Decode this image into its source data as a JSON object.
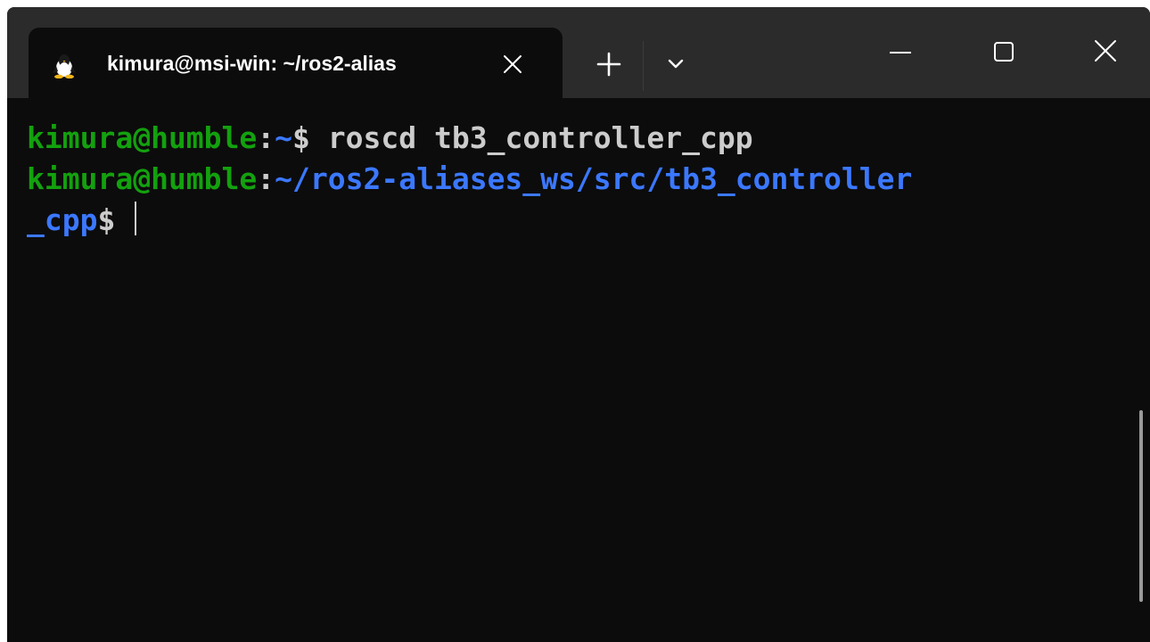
{
  "tab": {
    "title": "kimura@msi-win: ~/ros2-alias",
    "icon": "linux-penguin-icon"
  },
  "titlebar": {
    "new_tab_icon": "plus-icon",
    "dropdown_icon": "chevron-down-icon",
    "window_controls": [
      "minimize-icon",
      "maximize-icon",
      "close-icon"
    ]
  },
  "terminal": {
    "lines": [
      {
        "user_host": "kimura@humble",
        "sep": ":",
        "path": "~",
        "prompt": "$ ",
        "command": "roscd tb3_controller_cpp"
      },
      {
        "user_host": "kimura@humble",
        "sep": ":",
        "path": "~/ros2-aliases_ws/src/tb3_controller",
        "prompt": "",
        "command": ""
      },
      {
        "user_host": "",
        "sep": "",
        "path": "_cpp",
        "prompt": "$ ",
        "command": ""
      }
    ]
  },
  "colors": {
    "background": "#0c0c0c",
    "titlebar": "#2b2b2b",
    "user_host_green": "#13a10e",
    "path_blue": "#3b78ff",
    "text": "#cccccc"
  }
}
